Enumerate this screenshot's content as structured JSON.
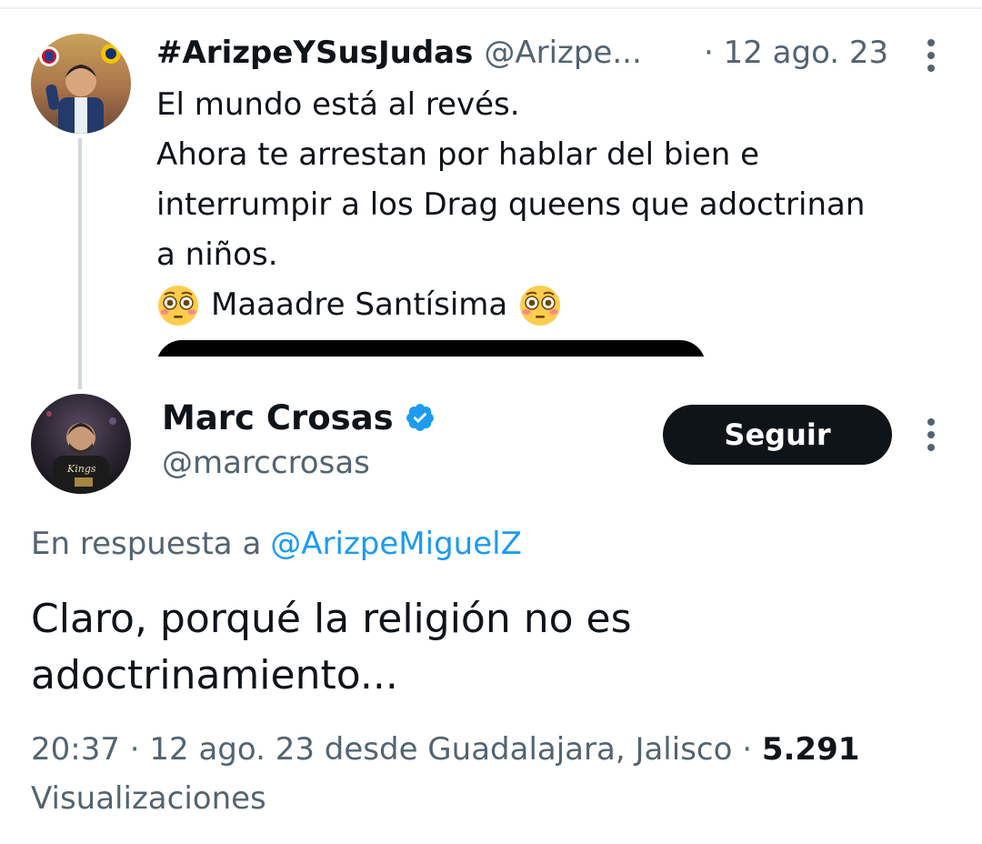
{
  "parent_tweet": {
    "display_name": "#ArizpeYSusJudas",
    "handle": "@Arizpe...",
    "date": "· 12 ago. 23",
    "text_lines": [
      "El mundo está al revés.",
      "Ahora te arrestan por hablar del bien e",
      "interrumpir a los Drag queens que adoctrinan",
      "a niños."
    ],
    "last_line_text": "Maaadre Santísima",
    "emoji": "flushed-face-emoji",
    "avatar": "avatar-arizpe",
    "more_icon": "more-vertical-icon"
  },
  "reply_tweet": {
    "display_name": "Marc Crosas",
    "verified_icon": "verified-badge-icon",
    "handle": "@marccrosas",
    "follow_label": "Seguir",
    "more_icon": "more-vertical-icon",
    "avatar": "avatar-marc-crosas",
    "replying_to_prefix": "En respuesta a",
    "replying_to_handle": "@ArizpeMiguelZ",
    "text_lines": [
      "Claro, porqué la religión no es",
      "adoctrinamiento..."
    ],
    "meta_line": "20:37 · 12 ago. 23 desde Guadalajara, Jalisco · ",
    "views_count": "5.291",
    "views_label": "Visualizaciones"
  },
  "colors": {
    "text_primary": "#0f1419",
    "text_secondary": "#536471",
    "link": "#1d9bf0",
    "verified": "#1d9bf0",
    "button_bg": "#0f1419",
    "thread_line": "#cfd9de"
  }
}
